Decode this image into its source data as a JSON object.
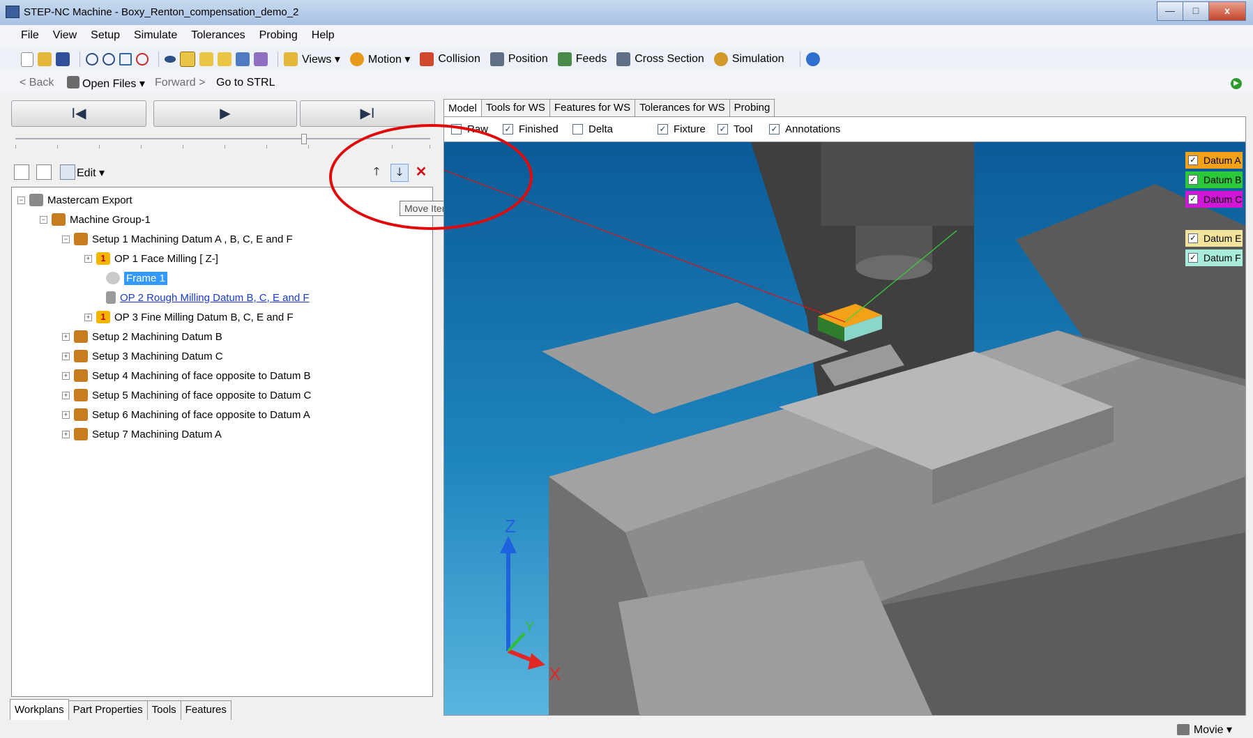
{
  "window": {
    "title": "STEP-NC Machine - Boxy_Renton_compensation_demo_2",
    "min_label": "—",
    "max_label": "□",
    "close_label": "x"
  },
  "menu": [
    "File",
    "View",
    "Setup",
    "Simulate",
    "Tolerances",
    "Probing",
    "Help"
  ],
  "toolbar": {
    "views": "Views ▾",
    "motion": "Motion ▾",
    "collision": "Collision",
    "position": "Position",
    "feeds": "Feeds",
    "cross_section": "Cross Section",
    "simulation": "Simulation"
  },
  "nav": {
    "back": "< Back",
    "open_files": "Open Files ▾",
    "forward": "Forward >",
    "goto": "Go to STRL"
  },
  "playback": {
    "first": "I◀",
    "play": "▶",
    "last": "▶I"
  },
  "edit": {
    "label": "Edit ▾",
    "up": "🡑",
    "down": "🡓",
    "delete": "✕",
    "tooltip": "Move Item Down"
  },
  "tree": {
    "root": "Mastercam Export",
    "group": "Machine Group-1",
    "setup1": "Setup 1 Machining Datum A , B, C, E and F",
    "op1": "OP 1 Face Milling [ Z-]",
    "frame1": "Frame 1",
    "op2": "OP 2 Rough Milling Datum B, C, E and F",
    "op3": "OP 3 Fine Milling Datum B, C, E and F",
    "setup2": "Setup 2 Machining Datum B",
    "setup3": "Setup 3 Machining Datum C",
    "setup4": "Setup 4 Machining of face opposite to Datum B",
    "setup5": "Setup 5 Machining of face opposite to Datum C",
    "setup6": "Setup 6 Machining of face opposite to Datum A",
    "setup7": "Setup 7 Machining Datum A",
    "op1_badge": "1"
  },
  "bottom_tabs": [
    "Workplans",
    "Part Properties",
    "Tools",
    "Features"
  ],
  "right_tabs": [
    "Model",
    "Tools for WS",
    "Features for WS",
    "Tolerances for WS",
    "Probing"
  ],
  "view_options": {
    "raw": {
      "label": "Raw",
      "checked": false
    },
    "finished": {
      "label": "Finished",
      "checked": true
    },
    "delta": {
      "label": "Delta",
      "checked": false
    },
    "fixture": {
      "label": "Fixture",
      "checked": true
    },
    "tool": {
      "label": "Tool",
      "checked": true
    },
    "annotations": {
      "label": "Annotations",
      "checked": true
    }
  },
  "datums": [
    {
      "label": "Datum A",
      "color": "#f4a11a",
      "checked": true
    },
    {
      "label": "Datum B",
      "color": "#2bc83a",
      "checked": true
    },
    {
      "label": "Datum C",
      "color": "#d017d7",
      "checked": true
    },
    {
      "label": "Datum E",
      "color": "#f3e39b",
      "checked": true
    },
    {
      "label": "Datum F",
      "color": "#a8eddc",
      "checked": true
    }
  ],
  "axes": {
    "x": "X",
    "y": "Y",
    "z": "Z"
  },
  "status": {
    "movie": "Movie ▾"
  },
  "check_mark": "✓"
}
